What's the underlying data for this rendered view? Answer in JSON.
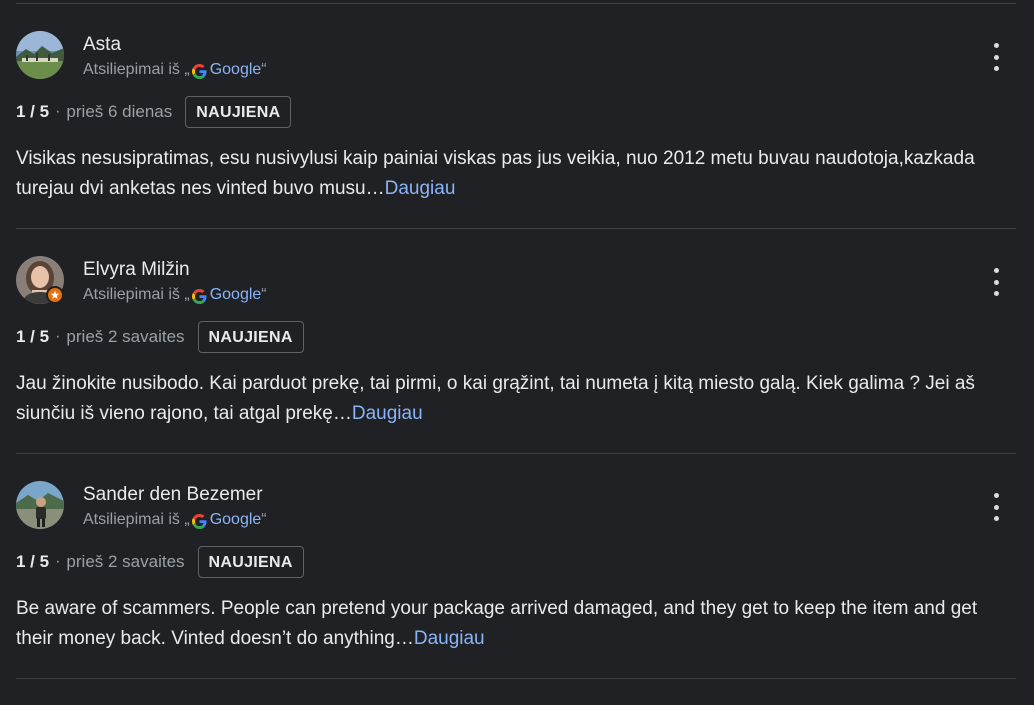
{
  "reviews": [
    {
      "name": "Asta",
      "source_prefix": "Atsiliepimai iš",
      "source_open_quote": "„",
      "source_brand": "Google",
      "source_close_quote": "“",
      "rating": "1 / 5",
      "separator": "·",
      "time": "prieš 6 dienas",
      "tag": "NAUJIENA",
      "text": "Visikas nesusipratimas, esu nusivylusi kaip painiai viskas pas jus veikia, nuo 2012 metu buvau naudotoja,kazkada turejau dvi anketas nes vinted buvo musu…",
      "more": "Daugiau",
      "avatar_icon": "landscape-photo-avatar",
      "has_local_guide_badge": false
    },
    {
      "name": "Elvyra Milžin",
      "source_prefix": "Atsiliepimai iš",
      "source_open_quote": "„",
      "source_brand": "Google",
      "source_close_quote": "“",
      "rating": "1 / 5",
      "separator": "·",
      "time": "prieš 2 savaites",
      "tag": "NAUJIENA",
      "text": "Jau žinokite nusibodo. Kai parduot prekę, tai pirmi, o kai grąžint, tai numeta į kitą miesto galą. Kiek galima ? Jei aš siunčiu iš vieno rajono, tai atgal prekę…",
      "more": "Daugiau",
      "avatar_icon": "portrait-photo-avatar",
      "has_local_guide_badge": true
    },
    {
      "name": "Sander den Bezemer",
      "source_prefix": "Atsiliepimai iš",
      "source_open_quote": "„",
      "source_brand": "Google",
      "source_close_quote": "“",
      "rating": "1 / 5",
      "separator": "·",
      "time": "prieš 2 savaites",
      "tag": "NAUJIENA",
      "text": "Be aware of scammers. People can pretend your package arrived damaged, and they get to keep the item and get their money back. Vinted doesn’t do anything…",
      "more": "Daugiau",
      "avatar_icon": "outdoor-person-photo-avatar",
      "has_local_guide_badge": false
    }
  ],
  "colors": {
    "background": "#202124",
    "text_primary": "#e8eaed",
    "text_secondary": "#9aa0a6",
    "link": "#8ab4f8",
    "divider": "#3c4043",
    "badge": "#e8710a"
  }
}
